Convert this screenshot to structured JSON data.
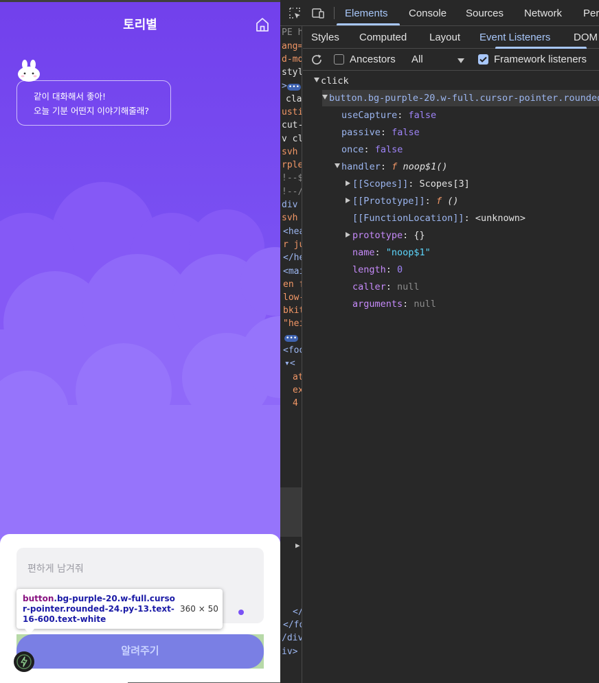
{
  "app": {
    "title": "토리별",
    "speech_line1": "같이 대화해서 좋아!",
    "speech_line2": "오늘 기분 어떤지 이야기해줄래?",
    "input_placeholder": "편하게 남겨줘",
    "submit_label": "알려주기",
    "inspect_tooltip": {
      "tag": "button",
      "selector": ".bg-purple-20.w-full.cursor-pointer.rounded-24.py-13.text-16-600.text-white",
      "dimensions": "360 × 50"
    },
    "colors": {
      "accent": "#7240ec",
      "button": "#7a7fe4"
    }
  },
  "devtools": {
    "main_tabs": [
      "Elements",
      "Console",
      "Sources",
      "Network",
      "Per"
    ],
    "active_main_tab": "Elements",
    "sub_tabs": [
      "Styles",
      "Computed",
      "Layout",
      "Event Listeners",
      "DOM"
    ],
    "active_sub_tab": "Event Listeners",
    "filter": {
      "ancestors_label": "Ancestors",
      "ancestors_checked": false,
      "type_select": "All",
      "framework_label": "Framework listeners",
      "framework_checked": true
    },
    "listener": {
      "event": "click",
      "node": "button.bg-purple-20.w-full.cursor-pointer.rounded",
      "props": [
        {
          "key": "useCapture",
          "value": "false"
        },
        {
          "key": "passive",
          "value": "false"
        },
        {
          "key": "once",
          "value": "false"
        }
      ],
      "handler_key": "handler",
      "handler_f": "f",
      "handler_name": "noop$1()",
      "handler_children": {
        "scopes_key": "[[Scopes]]",
        "scopes_val": "Scopes[3]",
        "proto_key": "[[Prototype]]",
        "proto_f": "f",
        "proto_val": "()",
        "loc_key": "[[FunctionLocation]]",
        "loc_val": "<unknown>",
        "prototype_key": "prototype",
        "prototype_val": "{}",
        "name_key": "name",
        "name_val": "\"noop$1\"",
        "length_key": "length",
        "length_val": "0",
        "caller_key": "caller",
        "caller_val": "null",
        "arguments_key": "arguments",
        "arguments_val": "null"
      }
    },
    "partial_source_lines": [
      "PE h",
      "ang=",
      "d-mo",
      "styl",
      "",
      "cla",
      "usti",
      "cut-",
      "v cl",
      "svh",
      "rple",
      "!--$",
      "!--/",
      "div",
      "svh",
      "<hea",
      "r ju",
      "</he",
      "<mai",
      "en f",
      "low-",
      "bkit",
      "\"hei",
      "",
      "<foo",
      "",
      "at",
      "ex",
      "4",
      "</",
      "</fo",
      "/div",
      "iv>"
    ]
  }
}
